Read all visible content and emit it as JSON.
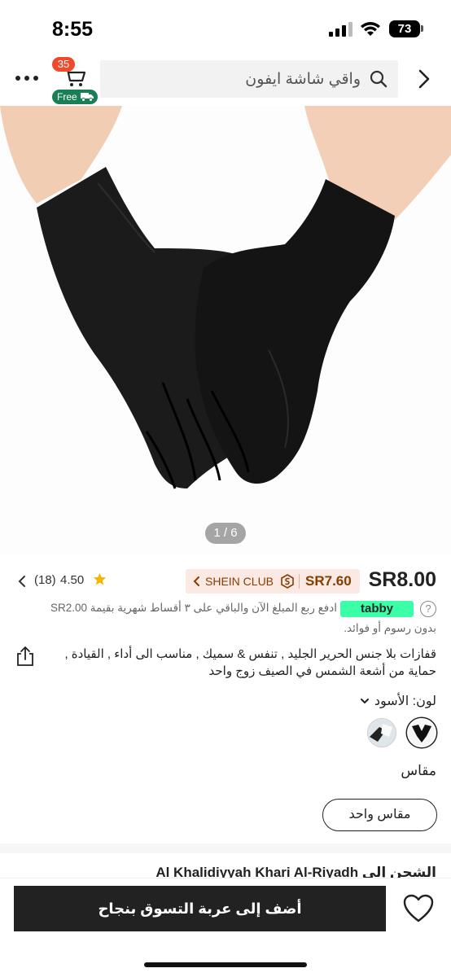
{
  "status_bar": {
    "time": "8:55",
    "battery": "73"
  },
  "nav": {
    "more_icon": "more-icon",
    "cart_count": "35",
    "free_label": "Free",
    "search_placeholder": "واقي شاشة ايفون",
    "back_icon": "chevron-right-icon"
  },
  "product": {
    "image_counter": "1 / 6",
    "price": "SR8.00",
    "club_price": "SR7.60",
    "club_label": "SHEIN CLUB",
    "rating_value": "4.50",
    "rating_count": "(18)",
    "tabby_brand": "tabby",
    "tabby_line1": "ادفع ربع المبلغ الآن والباقي على ٣ أقساط شهرية بقيمة SR2.00",
    "tabby_line2": "بدون رسوم أو فوائد.",
    "title": "قفازات بلا جنس الحرير الجليد , تنفس & سميك , مناسب الى أداء , القيادة , حماية من أشعة الشمس في الصيف زوج واحد",
    "color_label": "لون: الأسود",
    "size_heading": "مقاس",
    "size_option": "مقاس واحد",
    "shipping_text": "الشحن إلى Al Khalidiyyah Khari Al-Riyadh"
  },
  "bottom_bar": {
    "add_to_cart": "أضف إلى عربة التسوق بنجاح"
  },
  "colors": {
    "accent_dark": "#222222",
    "cart_badge": "#f04a2d",
    "free_green": "#198055",
    "club_bg": "#fbe9e3",
    "club_text": "#873c00",
    "tabby_green": "#3affa6",
    "star": "#f7b500"
  }
}
